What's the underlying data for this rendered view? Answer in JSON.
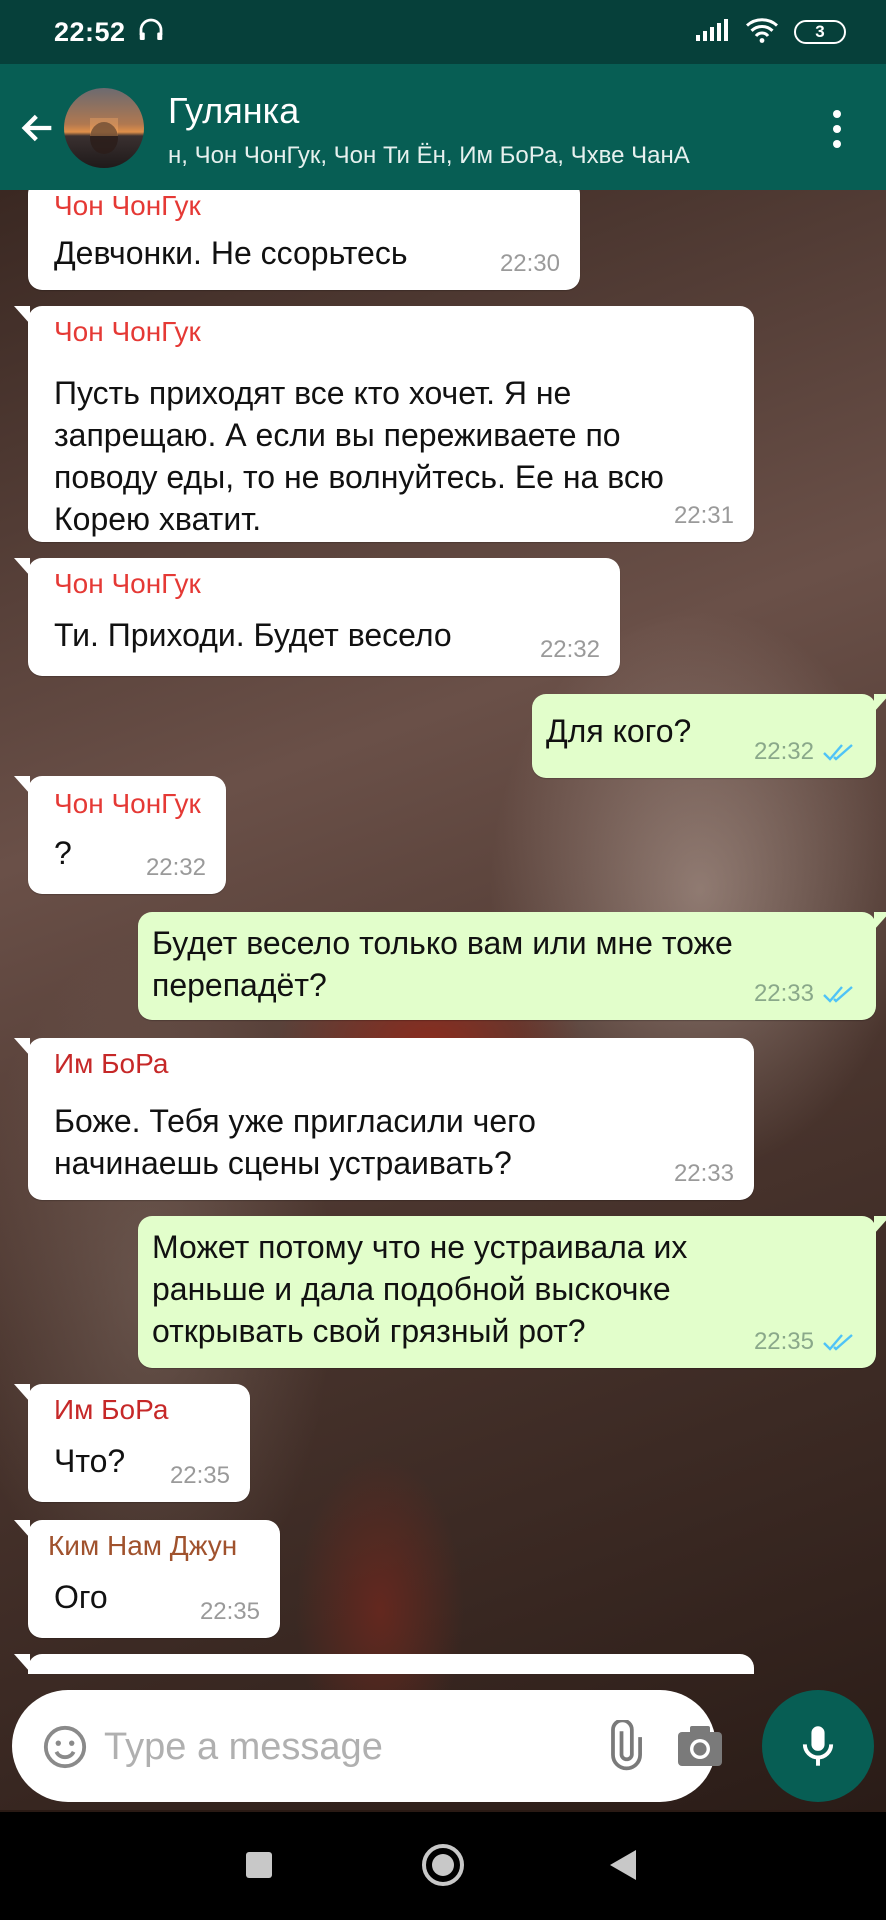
{
  "status_bar": {
    "time": "22:52",
    "battery": "3",
    "icons": [
      "headphones-icon",
      "signal-icon",
      "wifi-icon",
      "battery-icon"
    ]
  },
  "header": {
    "title": "Гулянка",
    "subtitle": "н, Чон ЧонГук, Чон Ти Ён, Им БоРа, Чхве ЧанА",
    "back_icon": "arrow-left-icon",
    "menu_icon": "more-vertical-icon"
  },
  "messages": [
    {
      "direction": "in",
      "sender": "Чон ЧонГук",
      "sender_color": "#e53935",
      "lines": [
        "Девчонки. Не ссорьтесь"
      ],
      "time": "22:30"
    },
    {
      "direction": "in",
      "sender": "Чон ЧонГук",
      "sender_color": "#e53935",
      "lines": [
        "Пусть приходят все кто хочет. Я не",
        "запрещаю. А если вы переживаете по",
        "поводу еды, то не волнуйтесь. Ее на всю",
        "Корею хватит."
      ],
      "time": "22:31"
    },
    {
      "direction": "in",
      "sender": "Чон ЧонГук",
      "sender_color": "#e53935",
      "lines": [
        "Ти. Приходи. Будет весело"
      ],
      "time": "22:32"
    },
    {
      "direction": "out",
      "lines": [
        "Для кого?"
      ],
      "time": "22:32",
      "status": "read"
    },
    {
      "direction": "in",
      "sender": "Чон ЧонГук",
      "sender_color": "#e53935",
      "lines": [
        "?"
      ],
      "time": "22:32"
    },
    {
      "direction": "out",
      "lines": [
        "Будет весело только вам или мне тоже",
        "перепадёт?"
      ],
      "time": "22:33",
      "status": "read"
    },
    {
      "direction": "in",
      "sender": "Им БоРа",
      "sender_color": "#c62828",
      "lines": [
        "Боже. Тебя уже пригласили чего",
        "начинаешь сцены устраивать?"
      ],
      "time": "22:33"
    },
    {
      "direction": "out",
      "lines": [
        "Может потому что не устраивала их",
        "раньше и дала подобной выскочке",
        "открывать свой грязный рот?"
      ],
      "time": "22:35",
      "status": "read"
    },
    {
      "direction": "in",
      "sender": "Им БоРа",
      "sender_color": "#c62828",
      "lines": [
        "Что?"
      ],
      "time": "22:35"
    },
    {
      "direction": "in",
      "sender": "Ким Нам Джун",
      "sender_color": "#a0522d",
      "lines": [
        "Ого"
      ],
      "time": "22:35"
    }
  ],
  "input": {
    "placeholder": "Type a message",
    "emoji_icon": "emoji-icon",
    "attach_icon": "paperclip-icon",
    "camera_icon": "camera-icon",
    "mic_icon": "microphone-icon"
  },
  "colors": {
    "header": "#075e54",
    "status_bar": "#06403a",
    "bubble_out": "#e2fecb",
    "bubble_in": "#ffffff",
    "read_ticks": "#4fc3f7"
  }
}
